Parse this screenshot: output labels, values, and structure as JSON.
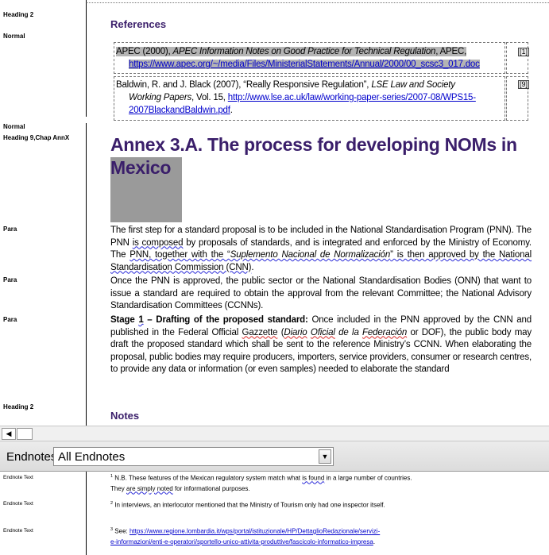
{
  "styles": {
    "heading2_a": "Heading 2",
    "normal_a": "Normal",
    "normal_b": "Normal",
    "heading9": "Heading 9,Chap AnnX",
    "para_1": "Para",
    "para_2": "Para",
    "para_3": "Para",
    "heading2_b": "Heading 2"
  },
  "references": {
    "heading": "References",
    "items": [
      {
        "prefix": "APEC (2000), ",
        "title": "APEC Information Notes on Good Practice for Technical Regulation",
        "suffix": ", APEC,",
        "url": "https://www.apec.org/~/media/Files/MinisterialStatements/Annual/2000/00_scsc3_017.doc",
        "num": "[1]"
      },
      {
        "prefix": "Baldwin, R. and J. Black (2007), “Really Responsive Regulation”, ",
        "title": "LSE Law and Society",
        "title2": "Working Papers",
        "suffix": ", Vol. 15,",
        "url": "http://www.lse.ac.uk/law/working-paper-series/2007-08/WPS15-2007BlackandBaldwin.pdf",
        "tail": ".",
        "num": "[9]"
      }
    ]
  },
  "annex": {
    "title": "Annex 3.A. The process for developing NOMs in Mexico"
  },
  "paragraphs": {
    "p1_a": "The first step for a standard proposal is to be included in the National Standardisation Program (PNN). The PNN ",
    "p1_wavy1": "is composed",
    "p1_b": " by proposals of standards, and is integrated and enforced by the Ministry of Economy. The ",
    "p1_wavy2": "PNN, together with the “",
    "p1_italic": "Suplemento Nacional de Normalización",
    "p1_wavy3": "” is then approved by the National Standardisation Commission (CNN)",
    "p1_end": ".",
    "p2": "Once the PNN is approved, the public sector or the National Standardisation Bodies (ONN) that want to issue a standard are required to obtain the approval from the relevant Committee; the National Advisory Standardisation Committees (CCNNs).",
    "p3_bold_a": "Stage ",
    "p3_bold_num": "1",
    "p3_bold_b": " – Drafting of the proposed standard:",
    "p3_a": " Once included in the PNN approved by the CNN and published in the Federal Official ",
    "p3_gazzette": "Gazzette",
    "p3_b": " (",
    "p3_diario": "Diario",
    "p3_c": " ",
    "p3_oficial": "Oficial",
    "p3_d": " de la ",
    "p3_federacion": "Federación",
    "p3_e": " or DOF), the public body may draft the proposed standard which shall be sent to the reference Ministry’s CCNN. When elaborating the proposal, public bodies may require producers, importers, service providers, consumer or research centres, to provide any data or information (or even samples) needed to elaborate the standard"
  },
  "notes": {
    "heading": "Notes"
  },
  "scrollbar": {
    "left_arrow": "◀"
  },
  "endnote_bar": {
    "label": "Endnotes",
    "selected": "All Endnotes",
    "dropdown_arrow": "▼"
  },
  "endnotes": [
    {
      "style": "Endnote Text",
      "num": "1",
      "a": " N.B. These features of the Mexican regulatory system match what ",
      "w1": "is found",
      "b": " in a large number of countries. They ",
      "w2": "are simply noted",
      "c": " for informational purposes."
    },
    {
      "style": "Endnote Text",
      "num": "2",
      "a": " In interviews, an interlocutor mentioned that the Ministry of Tourism only had one inspector itself."
    },
    {
      "style": "Endnote Text",
      "num": "3",
      "a": " See: ",
      "url": "https://www.regione.lombardia.it/wps/portal/istituzionale/HP/DettaglioRedazionale/servizi-e-informazioni/enti-e-operatori/sportello-unico-attivita-produttive/fascicolo-informatico-impresa",
      "tail": "."
    }
  ],
  "colors": {
    "heading": "#3a1e6a",
    "highlight": "#b4b4b4",
    "link": "#0000cc",
    "gray_block": "#9a9a9a"
  },
  "icons": [
    "scroll-left-arrow-icon",
    "dropdown-arrow-icon"
  ]
}
